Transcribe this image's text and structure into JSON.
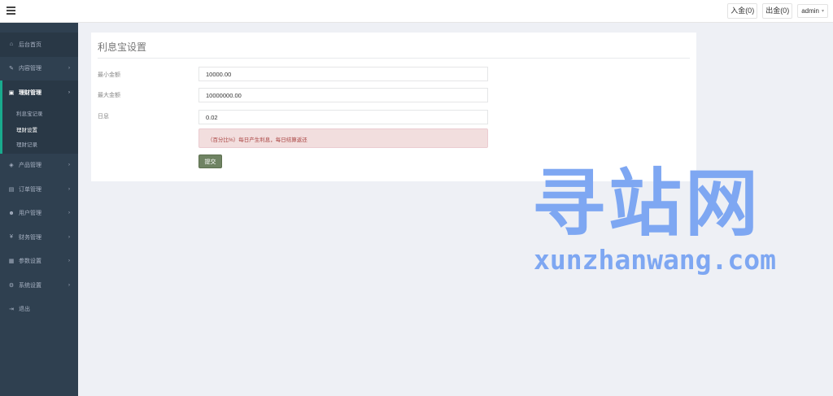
{
  "topbar": {
    "menu_icon": "hamburger-icon",
    "deposit_label": "入金(0)",
    "withdraw_label": "出金(0)",
    "user_label": "admin",
    "user_caret": "▾"
  },
  "sidebar": {
    "items": [
      {
        "label": "后台首页",
        "icon": "home-icon",
        "glyph": "⌂",
        "arrow": ""
      },
      {
        "label": "内容管理",
        "icon": "edit-icon",
        "glyph": "✎",
        "arrow": "›"
      },
      {
        "label": "理财管理",
        "icon": "wallet-icon",
        "glyph": "▣",
        "arrow": "›"
      },
      {
        "label": "产品管理",
        "icon": "product-icon",
        "glyph": "◈",
        "arrow": "›"
      },
      {
        "label": "订单管理",
        "icon": "order-icon",
        "glyph": "▤",
        "arrow": "›"
      },
      {
        "label": "用户管理",
        "icon": "user-icon",
        "glyph": "☻",
        "arrow": "›"
      },
      {
        "label": "财务管理",
        "icon": "yen-icon",
        "glyph": "¥",
        "arrow": "›"
      },
      {
        "label": "参数设置",
        "icon": "params-icon",
        "glyph": "▦",
        "arrow": "›"
      },
      {
        "label": "系统设置",
        "icon": "gears-icon",
        "glyph": "⚙",
        "arrow": "›"
      },
      {
        "label": "退出",
        "icon": "logout-icon",
        "glyph": "⇥",
        "arrow": ""
      }
    ],
    "subitems": [
      {
        "label": "利息宝记录"
      },
      {
        "label": "理财设置"
      },
      {
        "label": "理财记录"
      }
    ]
  },
  "panel": {
    "title": "利息宝设置",
    "fields": [
      {
        "label": "最小金额",
        "value": "10000.00"
      },
      {
        "label": "最大金额",
        "value": "10000000.00"
      },
      {
        "label": "日息",
        "value": "0.02"
      }
    ],
    "alert": "（百分比%）每日产生利息，每日结算返还",
    "submit_label": "提交"
  },
  "watermark": {
    "title": "寻站网",
    "url": "xunzhanwang.com"
  },
  "colors": {
    "sidebar_bg": "#2f4050",
    "accent": "#19aa8d",
    "button": "#6f8363",
    "alert_bg": "#f2dede",
    "watermark": "#7ea7f2"
  }
}
